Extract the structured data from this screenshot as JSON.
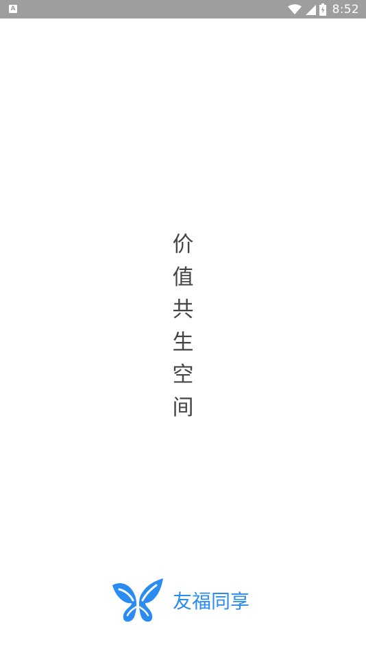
{
  "status_bar": {
    "notification_icon": "a-icon",
    "notification_glyph": "A",
    "time": "8:52",
    "icons": [
      "wifi-icon",
      "signal-icon",
      "battery-icon"
    ]
  },
  "splash": {
    "slogan_chars": [
      "价",
      "值",
      "共",
      "生",
      "空",
      "间"
    ]
  },
  "brand": {
    "logo_icon": "butterfly-logo-icon",
    "name": "友福同享",
    "color": "#2a8cf0"
  },
  "colors": {
    "status_bar_bg": "#9e9e9e",
    "background": "#ffffff",
    "slogan_text": "#444444"
  }
}
